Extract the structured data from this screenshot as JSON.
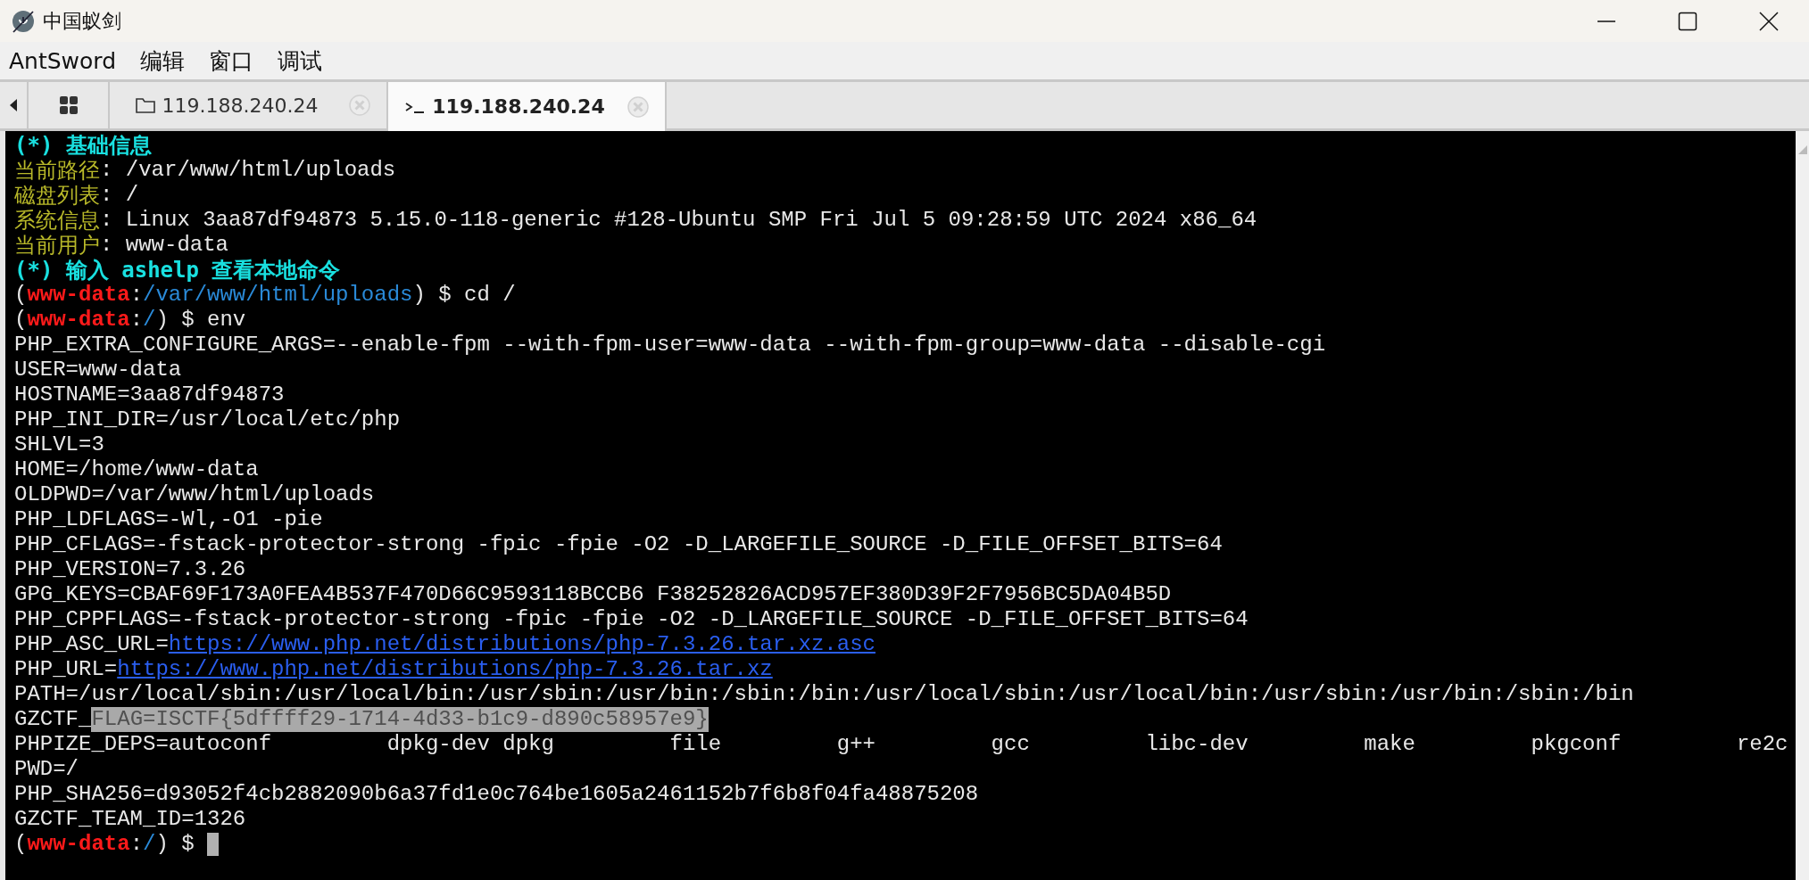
{
  "window": {
    "title": "中国蚁剑"
  },
  "menu": [
    {
      "label": "AntSword"
    },
    {
      "label": "编辑"
    },
    {
      "label": "窗口"
    },
    {
      "label": "调试"
    }
  ],
  "tabs": [
    {
      "kind": "home",
      "selected": false
    },
    {
      "kind": "files",
      "label": "119.188.240.24",
      "selected": false
    },
    {
      "kind": "terminal",
      "label": "119.188.240.24",
      "selected": true
    }
  ],
  "terminal": {
    "lines": [
      [
        {
          "kind": "heading",
          "text": "(*) 基础信息"
        }
      ],
      [
        {
          "kind": "label",
          "text": "当前路径"
        },
        {
          "kind": "plain",
          "text": ": /var/www/html/uploads"
        }
      ],
      [
        {
          "kind": "label",
          "text": "磁盘列表"
        },
        {
          "kind": "plain",
          "text": ": /"
        }
      ],
      [
        {
          "kind": "label",
          "text": "系统信息"
        },
        {
          "kind": "plain",
          "text": ": Linux 3aa87df94873 5.15.0-118-generic #128-Ubuntu SMP Fri Jul 5 09:28:59 UTC 2024 x86_64"
        }
      ],
      [
        {
          "kind": "label",
          "text": "当前用户"
        },
        {
          "kind": "plain",
          "text": ": www-data"
        }
      ],
      [
        {
          "kind": "heading",
          "text": "(*) 输入 ashelp 查看本地命令"
        }
      ],
      [
        {
          "kind": "plain",
          "text": "("
        },
        {
          "kind": "user",
          "text": "www-data"
        },
        {
          "kind": "plain",
          "text": ":"
        },
        {
          "kind": "path",
          "text": "/var/www/html/uploads"
        },
        {
          "kind": "plain",
          "text": ") $ cd /"
        }
      ],
      [
        {
          "kind": "plain",
          "text": "("
        },
        {
          "kind": "user",
          "text": "www-data"
        },
        {
          "kind": "plain",
          "text": ":"
        },
        {
          "kind": "path",
          "text": "/"
        },
        {
          "kind": "plain",
          "text": ") $ env"
        }
      ],
      [
        {
          "kind": "plain",
          "text": "PHP_EXTRA_CONFIGURE_ARGS=--enable-fpm --with-fpm-user=www-data --with-fpm-group=www-data --disable-cgi"
        }
      ],
      [
        {
          "kind": "plain",
          "text": "USER=www-data"
        }
      ],
      [
        {
          "kind": "plain",
          "text": "HOSTNAME=3aa87df94873"
        }
      ],
      [
        {
          "kind": "plain",
          "text": "PHP_INI_DIR=/usr/local/etc/php"
        }
      ],
      [
        {
          "kind": "plain",
          "text": "SHLVL=3"
        }
      ],
      [
        {
          "kind": "plain",
          "text": "HOME=/home/www-data"
        }
      ],
      [
        {
          "kind": "plain",
          "text": "OLDPWD=/var/www/html/uploads"
        }
      ],
      [
        {
          "kind": "plain",
          "text": "PHP_LDFLAGS=-Wl,-O1 -pie"
        }
      ],
      [
        {
          "kind": "plain",
          "text": "PHP_CFLAGS=-fstack-protector-strong -fpic -fpie -O2 -D_LARGEFILE_SOURCE -D_FILE_OFFSET_BITS=64"
        }
      ],
      [
        {
          "kind": "plain",
          "text": "PHP_VERSION=7.3.26"
        }
      ],
      [
        {
          "kind": "plain",
          "text": "GPG_KEYS=CBAF69F173A0FEA4B537F470D66C9593118BCCB6 F38252826ACD957EF380D39F2F7956BC5DA04B5D"
        }
      ],
      [
        {
          "kind": "plain",
          "text": "PHP_CPPFLAGS=-fstack-protector-strong -fpic -fpie -O2 -D_LARGEFILE_SOURCE -D_FILE_OFFSET_BITS=64"
        }
      ],
      [
        {
          "kind": "plain",
          "text": "PHP_ASC_URL="
        },
        {
          "kind": "link",
          "text": "https://www.php.net/distributions/php-7.3.26.tar.xz.asc"
        }
      ],
      [
        {
          "kind": "plain",
          "text": "PHP_URL="
        },
        {
          "kind": "link",
          "text": "https://www.php.net/distributions/php-7.3.26.tar.xz"
        }
      ],
      [
        {
          "kind": "plain",
          "text": "PATH=/usr/local/sbin:/usr/local/bin:/usr/sbin:/usr/bin:/sbin:/bin:/usr/local/sbin:/usr/local/bin:/usr/sbin:/usr/bin:/sbin:/bin"
        }
      ],
      [
        {
          "kind": "plain",
          "text": "GZCTF_"
        },
        {
          "kind": "highlighted",
          "text": "FLAG=ISCTF{5dffff29-1714-4d33-b1c9-d890c58957e9}"
        }
      ],
      [
        {
          "kind": "plain",
          "text": "PHPIZE_DEPS=autoconf         dpkg-dev dpkg         file         g++         gcc         libc-dev         make         pkgconf         re2c"
        }
      ],
      [
        {
          "kind": "plain",
          "text": "PWD=/"
        }
      ],
      [
        {
          "kind": "plain",
          "text": "PHP_SHA256=d93052f4cb2882090b6a37fd1e0c764be1605a2461152b7f6b8f04fa48875208"
        }
      ],
      [
        {
          "kind": "plain",
          "text": "GZCTF_TEAM_ID=1326"
        }
      ],
      [
        {
          "kind": "plain",
          "text": "("
        },
        {
          "kind": "user",
          "text": "www-data"
        },
        {
          "kind": "plain",
          "text": ":"
        },
        {
          "kind": "path",
          "text": "/"
        },
        {
          "kind": "plain",
          "text": ") $"
        },
        {
          "kind": "cursor"
        }
      ]
    ]
  }
}
